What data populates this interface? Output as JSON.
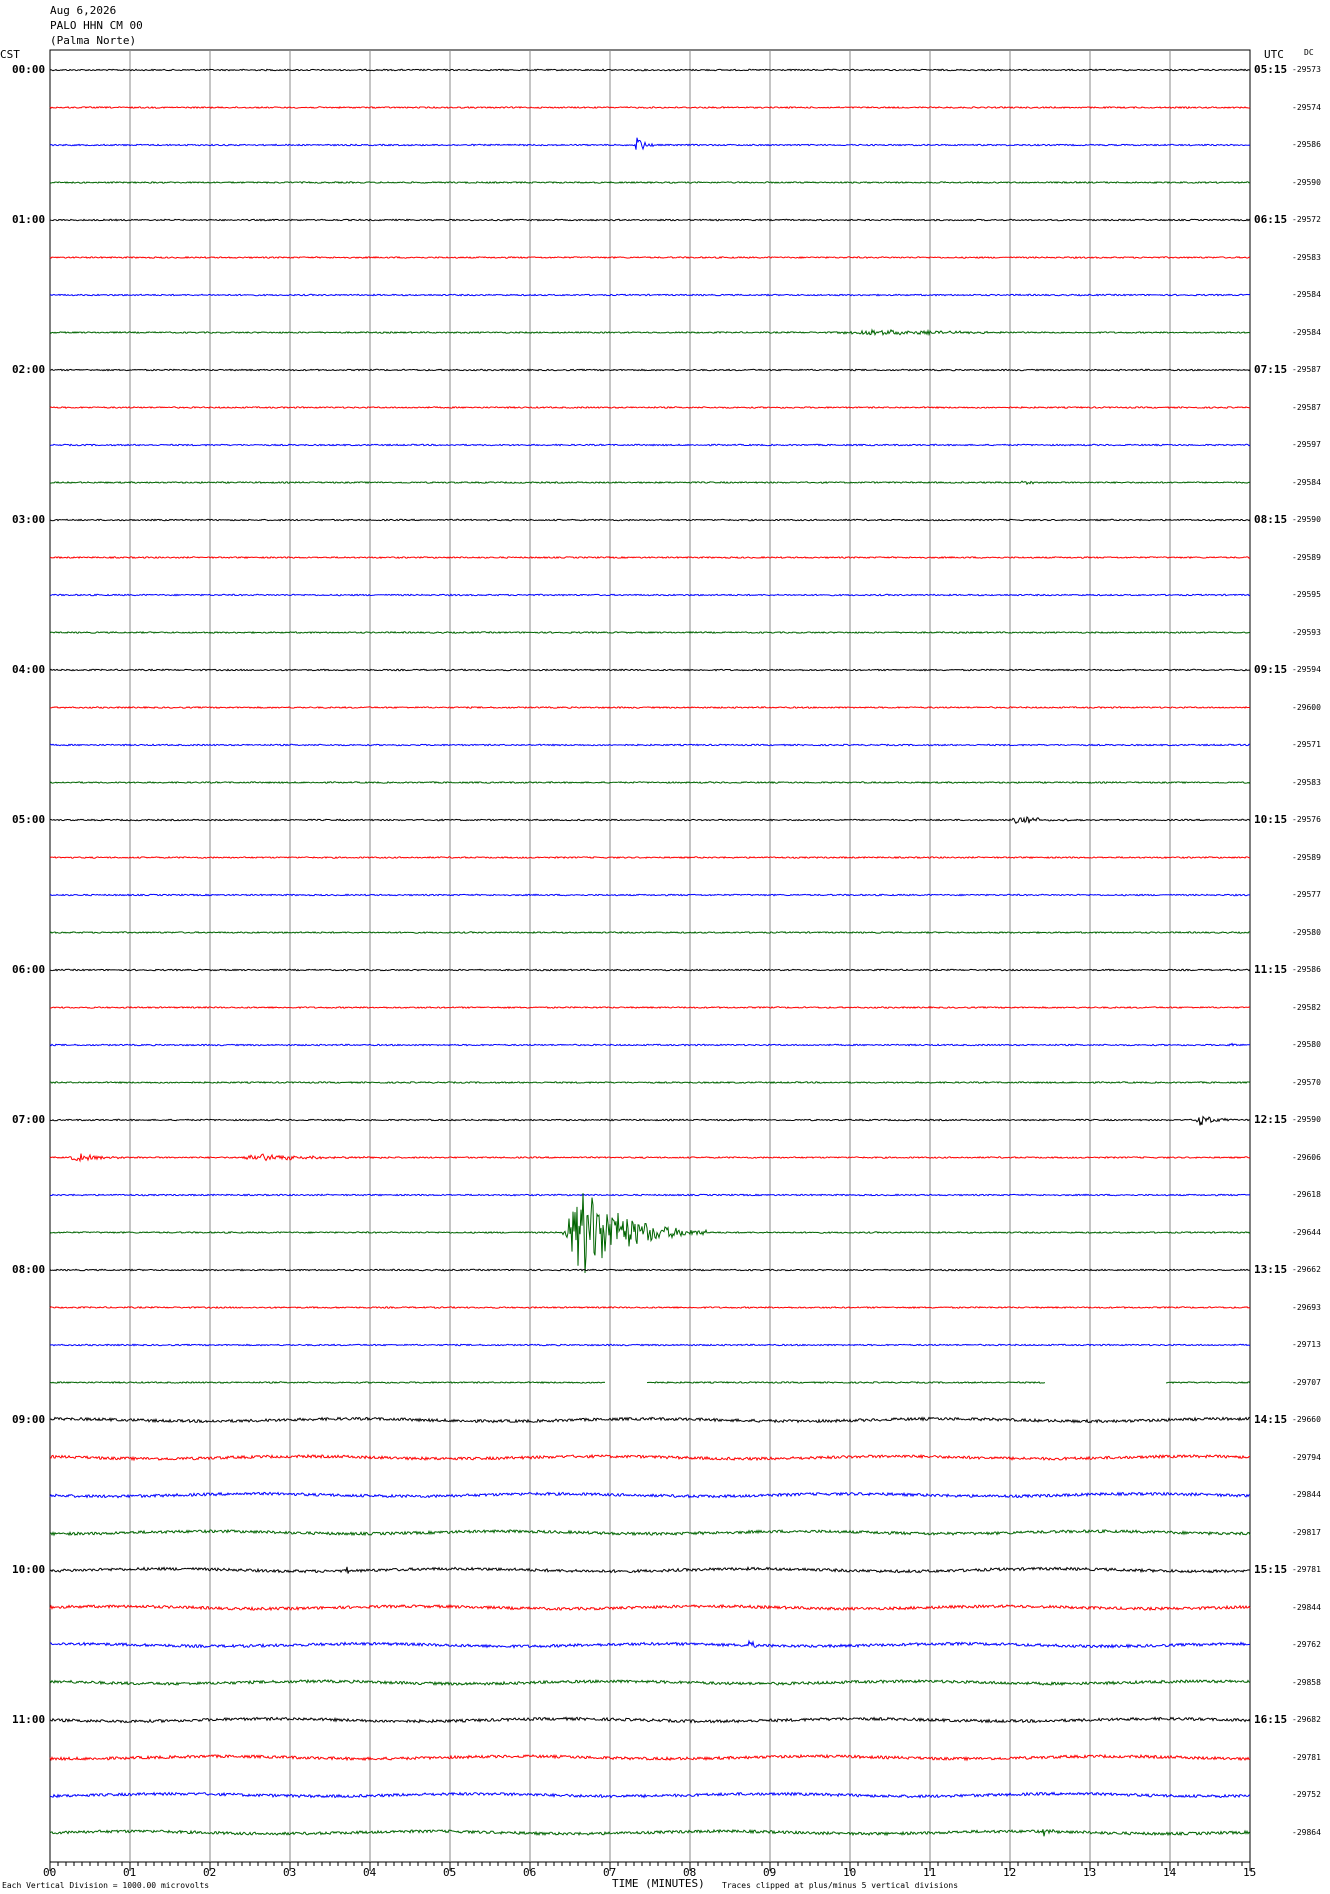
{
  "header": {
    "date": "Aug 6,2026",
    "station": "PALO HHN CM 00",
    "location": "(Palma Norte)",
    "left_tz": "CST",
    "right_tz": "UTC",
    "dc_label": "DC"
  },
  "footer": {
    "xlabel": "TIME (MINUTES)",
    "scale_note": "Each Vertical Division = 1000.00 microvolts",
    "clip_note": "Traces clipped at plus/minus 5 vertical divisions"
  },
  "colors": [
    "#000000",
    "#ff0000",
    "#0000ff",
    "#006400"
  ],
  "chart_data": {
    "type": "line",
    "title": "PALO HHN CM 00 (Palma Norte) Aug 6,2026",
    "xlabel": "TIME (MINUTES)",
    "x_ticks": [
      "00",
      "01",
      "02",
      "03",
      "04",
      "05",
      "06",
      "07",
      "08",
      "09",
      "10",
      "11",
      "12",
      "13",
      "14",
      "15"
    ],
    "xlim": [
      0,
      15
    ],
    "left_hour_labels": [
      "00:00",
      "01:00",
      "02:00",
      "03:00",
      "04:00",
      "05:00",
      "06:00",
      "07:00",
      "08:00",
      "09:00",
      "10:00",
      "11:00"
    ],
    "right_hour_labels": [
      "05:15",
      "06:15",
      "07:15",
      "08:15",
      "09:15",
      "10:15",
      "11:15",
      "12:15",
      "13:15",
      "14:15",
      "15:15",
      "16:15"
    ],
    "dc_offsets": [
      "-29573",
      "-29574",
      "-29586",
      "-29590",
      "-29572",
      "-29583",
      "-29584",
      "-29584",
      "-29587",
      "-29587",
      "-29597",
      "-29584",
      "-29590",
      "-29589",
      "-29595",
      "-29593",
      "-29594",
      "-29600",
      "-29571",
      "-29583",
      "-29576",
      "-29589",
      "-29577",
      "-29580",
      "-29586",
      "-29582",
      "-29580",
      "-29570",
      "-29590",
      "-29606",
      "-29618",
      "-29644",
      "-29662",
      "-29693",
      "-29713",
      "-29707",
      "-29660",
      "-29794",
      "-29844",
      "-29817",
      "-29781",
      "-29844",
      "-29762",
      "-29858",
      "-29682",
      "-29781",
      "-29752",
      "-29864"
    ],
    "events": [
      {
        "trace": 2,
        "minute": 7.3,
        "amp": 9,
        "dur": 0.3
      },
      {
        "trace": 7,
        "minute": 9.8,
        "amp": 3,
        "dur": 3.0
      },
      {
        "trace": 11,
        "minute": 12.1,
        "amp": 2,
        "dur": 0.5
      },
      {
        "trace": 20,
        "minute": 12.0,
        "amp": 5,
        "dur": 0.9
      },
      {
        "trace": 26,
        "minute": 14.7,
        "amp": 4,
        "dur": 0.2
      },
      {
        "trace": 28,
        "minute": 14.3,
        "amp": 6,
        "dur": 0.6
      },
      {
        "trace": 29,
        "minute": 0.2,
        "amp": 4,
        "dur": 1.0
      },
      {
        "trace": 29,
        "minute": 2.3,
        "amp": 4,
        "dur": 2.0
      },
      {
        "trace": 31,
        "minute": 6.4,
        "amp": 45,
        "dur": 1.8
      },
      {
        "trace": 40,
        "minute": 3.7,
        "amp": 4,
        "dur": 0.1
      },
      {
        "trace": 42,
        "minute": 8.7,
        "amp": 9,
        "dur": 0.2
      },
      {
        "trace": 47,
        "minute": 12.4,
        "amp": 5,
        "dur": 0.2
      }
    ],
    "gaps": [
      {
        "trace": 35,
        "from": 6.95,
        "to": 7.45
      },
      {
        "trace": 35,
        "from": 12.45,
        "to": 13.95
      }
    ]
  }
}
